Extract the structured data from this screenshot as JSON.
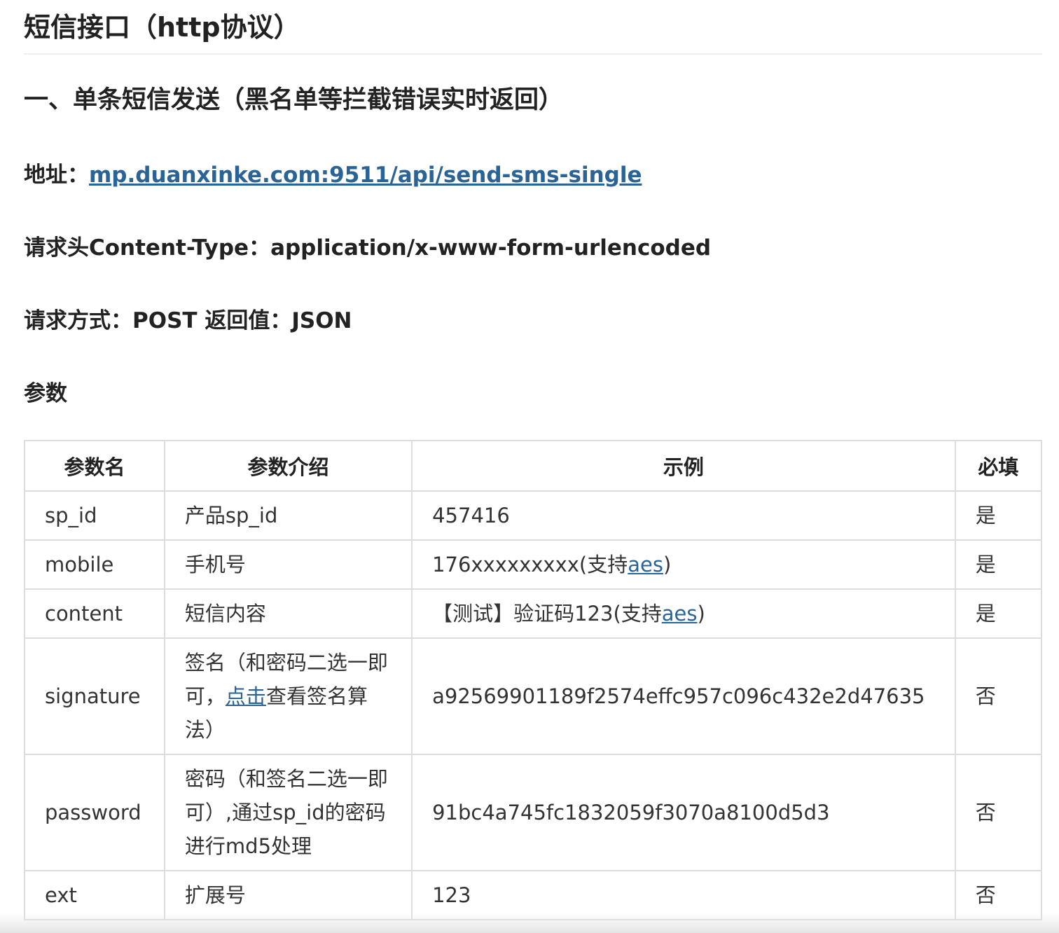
{
  "title": "短信接口（http协议）",
  "section_title": "一、单条短信发送（黑名单等拦截错误实时返回）",
  "address": {
    "label": "地址：",
    "url": "mp.duanxinke.com:9511/api/send-sms-single"
  },
  "content_type": {
    "label": "请求头Content-Type：",
    "value": "application/x-www-form-urlencoded"
  },
  "method": {
    "label": "请求方式：",
    "value": "POST",
    "return_label": "返回值：",
    "return_value": "JSON"
  },
  "params_heading": "参数",
  "table": {
    "headers": [
      "参数名",
      "参数介绍",
      "示例",
      "必填"
    ],
    "rows": [
      {
        "name": "sp_id",
        "desc": "产品sp_id",
        "example": "457416",
        "required": "是"
      },
      {
        "name": "mobile",
        "desc": "手机号",
        "example_prefix": "176xxxxxxxxx(支持",
        "example_link": "aes",
        "example_suffix": ")",
        "required": "是"
      },
      {
        "name": "content",
        "desc": "短信内容",
        "example_prefix": "【测试】验证码123(支持",
        "example_link": "aes",
        "example_suffix": ")",
        "required": "是"
      },
      {
        "name": "signature",
        "desc_prefix": "签名（和密码二选一即可，",
        "desc_link": "点击",
        "desc_suffix": "查看签名算法）",
        "example": "a92569901189f2574effc957c096c432e2d47635",
        "required": "否"
      },
      {
        "name": "password",
        "desc": "密码（和签名二选一即可）,通过sp_id的密码进行md5处理",
        "example": "91bc4a745fc1832059f3070a8100d5d3",
        "required": "否"
      },
      {
        "name": "ext",
        "desc": "扩展号",
        "example": "123",
        "required": "否"
      }
    ]
  }
}
